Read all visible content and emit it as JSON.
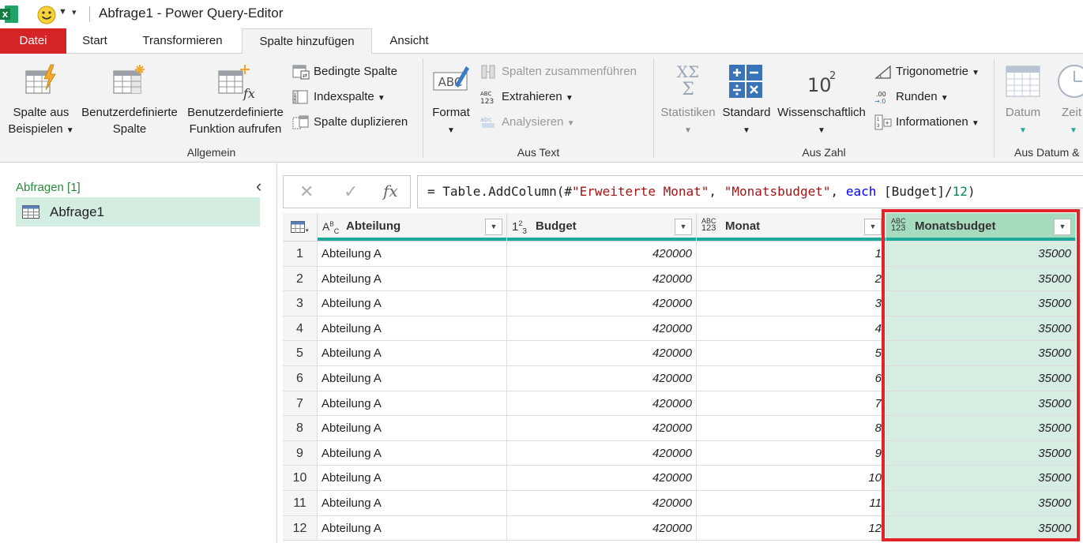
{
  "window": {
    "title": "Abfrage1 - Power Query-Editor"
  },
  "tabs": [
    {
      "label": "Datei"
    },
    {
      "label": "Start"
    },
    {
      "label": "Transformieren"
    },
    {
      "label": "Spalte hinzufügen",
      "active": true
    },
    {
      "label": "Ansicht"
    }
  ],
  "ribbon": {
    "allgemein": {
      "label": "Allgemein",
      "spalte_aus_beispielen": [
        "Spalte aus",
        "Beispielen"
      ],
      "benutzer_spalte": [
        "Benutzerdefinierte",
        "Spalte"
      ],
      "benutzer_funktion": [
        "Benutzerdefinierte",
        "Funktion aufrufen"
      ],
      "bedingte_spalte": "Bedingte Spalte",
      "indexspalte": "Indexspalte",
      "spalte_duplizieren": "Spalte duplizieren"
    },
    "aus_text": {
      "label": "Aus Text",
      "format": "Format",
      "zusammenfuehren": "Spalten zusammenführen",
      "extrahieren": "Extrahieren",
      "analysieren": "Analysieren"
    },
    "aus_zahl": {
      "label": "Aus Zahl",
      "statistiken": "Statistiken",
      "standard": "Standard",
      "wissenschaftlich": "Wissenschaftlich",
      "trigonometrie": "Trigonometrie",
      "runden": "Runden",
      "informationen": "Informationen"
    },
    "aus_datum": {
      "label": "Aus Datum &",
      "datum": "Datum",
      "zeit": "Zeit"
    }
  },
  "queries": {
    "header": "Abfragen [1]",
    "items": [
      "Abfrage1"
    ]
  },
  "formula": {
    "prefix": "= Table.AddColumn(#",
    "arg1": "\"Erweiterte Monat\"",
    "sep1": ", ",
    "arg2": "\"Monatsbudget\"",
    "sep2": ", ",
    "kw": "each",
    "body": " [Budget]/",
    "num": "12",
    "close": ")"
  },
  "table": {
    "columns": [
      {
        "name": "Abteilung",
        "type": "ABC"
      },
      {
        "name": "Budget",
        "type": "123"
      },
      {
        "name": "Monat",
        "type": "ABC123"
      },
      {
        "name": "Monatsbudget",
        "type": "ABC123",
        "selected": true
      }
    ],
    "rows": [
      [
        "1",
        "Abteilung A",
        "420000",
        "1",
        "35000"
      ],
      [
        "2",
        "Abteilung A",
        "420000",
        "2",
        "35000"
      ],
      [
        "3",
        "Abteilung A",
        "420000",
        "3",
        "35000"
      ],
      [
        "4",
        "Abteilung A",
        "420000",
        "4",
        "35000"
      ],
      [
        "5",
        "Abteilung A",
        "420000",
        "5",
        "35000"
      ],
      [
        "6",
        "Abteilung A",
        "420000",
        "6",
        "35000"
      ],
      [
        "7",
        "Abteilung A",
        "420000",
        "7",
        "35000"
      ],
      [
        "8",
        "Abteilung A",
        "420000",
        "8",
        "35000"
      ],
      [
        "9",
        "Abteilung A",
        "420000",
        "9",
        "35000"
      ],
      [
        "10",
        "Abteilung A",
        "420000",
        "10",
        "35000"
      ],
      [
        "11",
        "Abteilung A",
        "420000",
        "11",
        "35000"
      ],
      [
        "12",
        "Abteilung A",
        "420000",
        "12",
        "35000"
      ]
    ]
  },
  "colors": {
    "file_tab": "#d42425",
    "accent_teal": "#1ea89a",
    "selected_column": "#d6ede1",
    "highlight_border": "#e1242a",
    "query_selected": "#d3ede0"
  }
}
